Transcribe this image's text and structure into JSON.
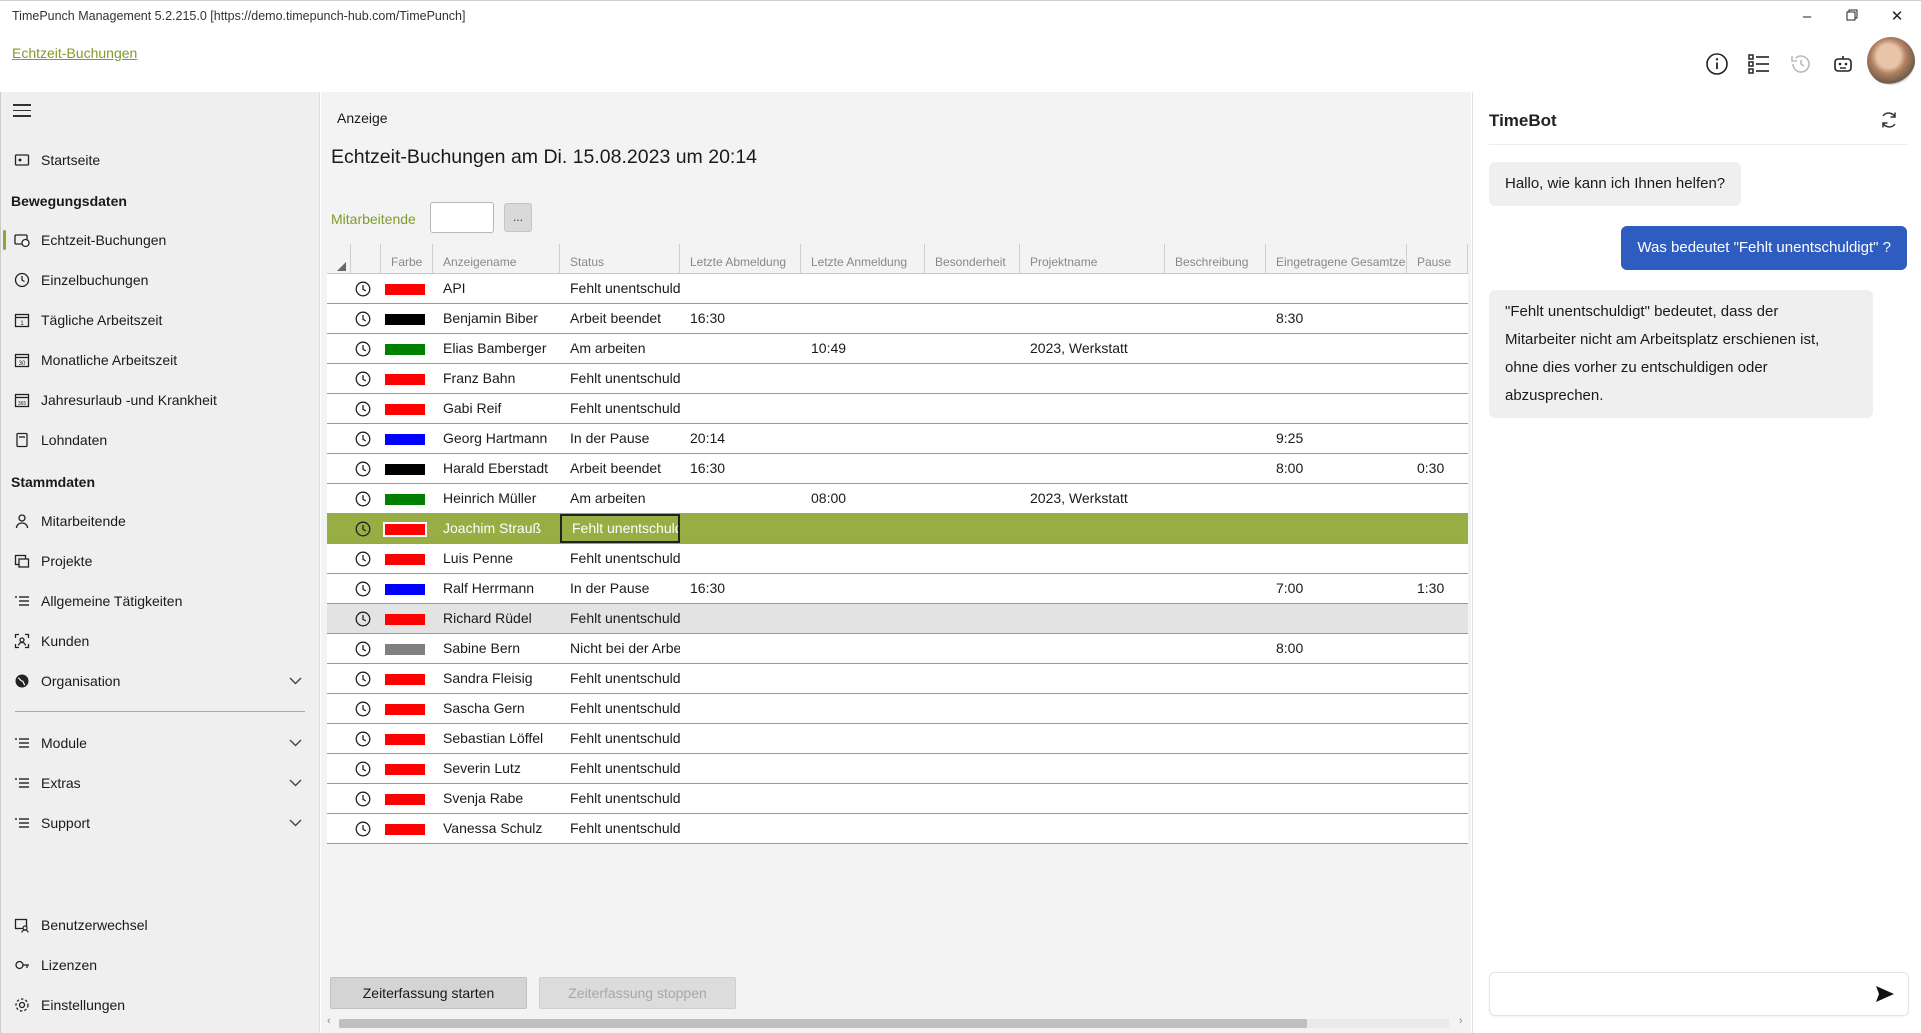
{
  "window": {
    "title": "TimePunch Management 5.2.215.0 [https://demo.timepunch-hub.com/TimePunch]"
  },
  "header": {
    "breadcrumb": "Echtzeit-Buchungen"
  },
  "sidebar": {
    "items_top": [
      {
        "label": "Startseite",
        "icon": "home-icon"
      }
    ],
    "section_movement": "Bewegungsdaten",
    "movement_items": [
      {
        "label": "Echtzeit-Buchungen",
        "icon": "realtime-clock-icon",
        "active": true
      },
      {
        "label": "Einzelbuchungen",
        "icon": "clock-icon"
      },
      {
        "label": "Tägliche Arbeitszeit",
        "icon": "calendar-day-icon"
      },
      {
        "label": "Monatliche Arbeitszeit",
        "icon": "calendar-month-icon"
      },
      {
        "label": "Jahresurlaub -und Krankheit",
        "icon": "calendar-year-icon"
      },
      {
        "label": "Lohndaten",
        "icon": "calculator-icon"
      }
    ],
    "section_master": "Stammdaten",
    "master_items": [
      {
        "label": "Mitarbeitende",
        "icon": "person-icon"
      },
      {
        "label": "Projekte",
        "icon": "projects-icon"
      },
      {
        "label": "Allgemeine Tätigkeiten",
        "icon": "list-icon"
      },
      {
        "label": "Kunden",
        "icon": "customer-icon"
      },
      {
        "label": "Organisation",
        "icon": "globe-icon"
      }
    ],
    "expand_items": [
      {
        "label": "Module",
        "icon": "list-icon"
      },
      {
        "label": "Extras",
        "icon": "list-icon"
      },
      {
        "label": "Support",
        "icon": "list-icon"
      }
    ],
    "bottom_items": [
      {
        "label": "Benutzerwechsel",
        "icon": "switch-user-icon"
      },
      {
        "label": "Lizenzen",
        "icon": "license-icon"
      },
      {
        "label": "Einstellungen",
        "icon": "gear-icon"
      }
    ]
  },
  "main": {
    "tab": "Anzeige",
    "title": "Echtzeit-Buchungen am Di. 15.08.2023 um 20:14",
    "filter_label": "Mitarbeitende",
    "filter_button": "...",
    "columns": [
      "Farbe",
      "Anzeigename",
      "Status",
      "Letzte Abmeldung",
      "Letzte Anmeldung",
      "Besonderheit",
      "Projektname",
      "Beschreibung",
      "Eingetragene Gesamtzeit",
      "Pause"
    ],
    "rows": [
      {
        "color": "#ff0000",
        "name": "API",
        "status": "Fehlt unentschuldigt",
        "logout": "",
        "login": "",
        "special": "",
        "project": "",
        "desc": "",
        "total": "",
        "pause": ""
      },
      {
        "color": "#000000",
        "name": "Benjamin Biber",
        "status": "Arbeit beendet",
        "logout": "16:30",
        "login": "",
        "special": "",
        "project": "",
        "desc": "",
        "total": "8:30",
        "pause": ""
      },
      {
        "color": "#008000",
        "name": "Elias Bamberger",
        "status": "Am arbeiten",
        "logout": "",
        "login": "10:49",
        "special": "",
        "project": "2023, Werkstatt",
        "desc": "",
        "total": "",
        "pause": ""
      },
      {
        "color": "#ff0000",
        "name": "Franz Bahn",
        "status": "Fehlt unentschuldigt",
        "logout": "",
        "login": "",
        "special": "",
        "project": "",
        "desc": "",
        "total": "",
        "pause": ""
      },
      {
        "color": "#ff0000",
        "name": "Gabi Reif",
        "status": "Fehlt unentschuldigt",
        "logout": "",
        "login": "",
        "special": "",
        "project": "",
        "desc": "",
        "total": "",
        "pause": ""
      },
      {
        "color": "#0000ff",
        "name": "Georg Hartmann",
        "status": "In der Pause",
        "logout": "20:14",
        "login": "",
        "special": "",
        "project": "",
        "desc": "",
        "total": "9:25",
        "pause": ""
      },
      {
        "color": "#000000",
        "name": "Harald Eberstadt",
        "status": "Arbeit beendet",
        "logout": "16:30",
        "login": "",
        "special": "",
        "project": "",
        "desc": "",
        "total": "8:00",
        "pause": "0:30"
      },
      {
        "color": "#008000",
        "name": "Heinrich  Müller",
        "status": "Am arbeiten",
        "logout": "",
        "login": "08:00",
        "special": "",
        "project": "2023, Werkstatt",
        "desc": "",
        "total": "",
        "pause": ""
      },
      {
        "color": "#ff0000",
        "name": "Joachim Strauß",
        "status": "Fehlt unentschuldigt",
        "logout": "",
        "login": "",
        "special": "",
        "project": "",
        "desc": "",
        "total": "",
        "pause": "",
        "selected": true
      },
      {
        "color": "#ff0000",
        "name": "Luis Penne",
        "status": "Fehlt unentschuldigt",
        "logout": "",
        "login": "",
        "special": "",
        "project": "",
        "desc": "",
        "total": "",
        "pause": ""
      },
      {
        "color": "#0000ff",
        "name": "Ralf Herrmann",
        "status": "In der Pause",
        "logout": "16:30",
        "login": "",
        "special": "",
        "project": "",
        "desc": "",
        "total": "7:00",
        "pause": "1:30"
      },
      {
        "color": "#ff0000",
        "name": "Richard Rüdel",
        "status": "Fehlt unentschuldigt",
        "logout": "",
        "login": "",
        "special": "",
        "project": "",
        "desc": "",
        "total": "",
        "pause": "",
        "hover": true
      },
      {
        "color": "#808080",
        "name": "Sabine Bern",
        "status": "Nicht bei der Arbeit",
        "logout": "",
        "login": "",
        "special": "",
        "project": "",
        "desc": "",
        "total": "8:00",
        "pause": ""
      },
      {
        "color": "#ff0000",
        "name": "Sandra Fleisig",
        "status": "Fehlt unentschuldigt",
        "logout": "",
        "login": "",
        "special": "",
        "project": "",
        "desc": "",
        "total": "",
        "pause": ""
      },
      {
        "color": "#ff0000",
        "name": "Sascha Gern",
        "status": "Fehlt unentschuldigt",
        "logout": "",
        "login": "",
        "special": "",
        "project": "",
        "desc": "",
        "total": "",
        "pause": ""
      },
      {
        "color": "#ff0000",
        "name": "Sebastian Löffel",
        "status": "Fehlt unentschuldigt",
        "logout": "",
        "login": "",
        "special": "",
        "project": "",
        "desc": "",
        "total": "",
        "pause": ""
      },
      {
        "color": "#ff0000",
        "name": "Severin Lutz",
        "status": "Fehlt unentschuldigt",
        "logout": "",
        "login": "",
        "special": "",
        "project": "",
        "desc": "",
        "total": "",
        "pause": ""
      },
      {
        "color": "#ff0000",
        "name": "Svenja Rabe",
        "status": "Fehlt unentschuldigt",
        "logout": "",
        "login": "",
        "special": "",
        "project": "",
        "desc": "",
        "total": "",
        "pause": ""
      },
      {
        "color": "#ff0000",
        "name": "Vanessa Schulz",
        "status": "Fehlt unentschuldigt",
        "logout": "",
        "login": "",
        "special": "",
        "project": "",
        "desc": "",
        "total": "",
        "pause": ""
      }
    ],
    "start_button": "Zeiterfassung starten",
    "stop_button": "Zeiterfassung stoppen"
  },
  "chat": {
    "title": "TimeBot",
    "messages": [
      {
        "from": "bot",
        "text": "Hallo, wie kann ich Ihnen helfen?"
      },
      {
        "from": "user",
        "text": "Was bedeutet \"Fehlt unentschuldigt\" ?"
      },
      {
        "from": "bot",
        "lines": [
          "\"Fehlt unentschuldigt\" bedeutet, dass der",
          "Mitarbeiter nicht am Arbeitsplatz erschienen ist,",
          "ohne dies vorher zu entschuldigen oder",
          "abzusprechen."
        ]
      }
    ],
    "input_placeholder": ""
  },
  "colors": {
    "accent": "#98ad44",
    "link": "#7f9b2a",
    "user_bubble": "#2f5cbf"
  }
}
